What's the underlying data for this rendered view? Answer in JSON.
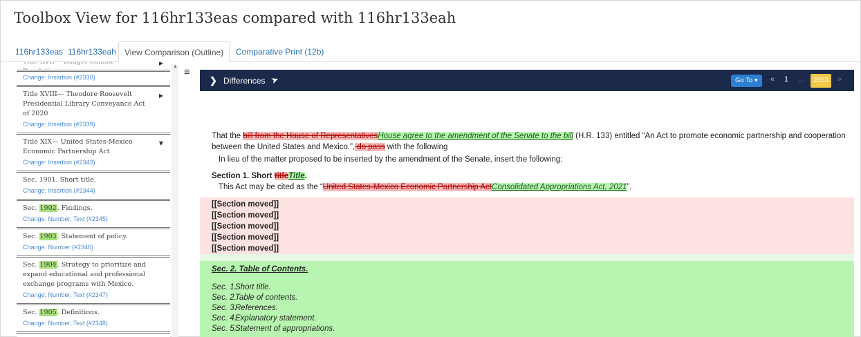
{
  "page_title": "Toolbox View for 116hr133eas compared with 116hr133eah",
  "tabs": [
    {
      "label": "116hr133eas"
    },
    {
      "label": "116hr133eah"
    },
    {
      "label": "View Comparison (Outline)"
    },
    {
      "label": "Comparative Print (12b)"
    }
  ],
  "sidebar": {
    "items": [
      {
        "title": "Title XVII— Budget Cannot Resolution",
        "change": "Change: Insertion (#2330)"
      },
      {
        "title": "Title XVIII— Theodore Roosevelt Presidential Library Conveyance Act of 2020",
        "change": "Change: Insertion (#2339)"
      },
      {
        "title": "Title XIX— United States-Mexico Economic Partnership Act",
        "change": "Change: Insertion (#2343)"
      },
      {
        "title": "Sec. 1901. Short title.",
        "change": "Change: Insertion (#2344)"
      },
      {
        "title_pre": "Sec. ",
        "title_hl": "1902",
        "title_post": ". Findings.",
        "change": "Change: Number, Text (#2345)"
      },
      {
        "title_pre": "Sec. ",
        "title_hl": "1903",
        "title_post": ". Statement of policy.",
        "change": "Change: Number (#2346)"
      },
      {
        "title_pre": "Sec. ",
        "title_hl": "1904",
        "title_post": ". Strategy to prioritize and expand educational and professional exchange programs with Mexico.",
        "change": "Change: Number, Text (#2347)"
      },
      {
        "title_pre": "Sec. ",
        "title_hl": "1905",
        "title_post": ". Definitions.",
        "change": "Change: Number, Text (#2348)"
      }
    ]
  },
  "differences": {
    "label": "Differences",
    "goto_label": "Go To ▾",
    "prev_icon": "«",
    "page_first": "1",
    "page_dots": "...",
    "page_last": "2353",
    "next_icon": "»"
  },
  "doc": {
    "p1_a": "That the ",
    "p1_del": "bill from the House of Representatives",
    "p1_ins": "House agree to the amendment of the Senate to the bill",
    "p1_b": " (H.R. 133) entitled “An Act to promote economic partnership and cooperation between the United States and Mexico.”,",
    "p1_del2": " do pass",
    "p1_c": " with the following",
    "p2": "In lieu of the matter proposed to be inserted by the amendment of the Senate, insert the following:",
    "sec_head_a": "Section 1. Short ",
    "sec_head_del": "title",
    "sec_head_ins": "Title",
    "sec_head_b": ".",
    "sec_body_a": "This Act may be cited as the “",
    "sec_body_del": "United States-Mexico Economic Partnership Act",
    "sec_body_ins": "Consolidated Appropriations Act, 2021",
    "sec_body_b": "”.",
    "moved": [
      "[[Section moved]]",
      "[[Section moved]]",
      "[[Section moved]]",
      "[[Section moved]]",
      "[[Section moved]]"
    ],
    "toc_title": "Sec. 2. Table of Contents.",
    "toc": [
      {
        "sec": "Sec. 1.",
        "title": "Short title."
      },
      {
        "sec": "Sec. 2.",
        "title": "Table of contents."
      },
      {
        "sec": "Sec. 3.",
        "title": "References."
      },
      {
        "sec": "Sec. 4.",
        "title": "Explanatory statement."
      },
      {
        "sec": "Sec. 5.",
        "title": "Statement of appropriations."
      }
    ]
  },
  "colors": {
    "nav_bar": "#1b2a4a",
    "deletion": "#f6b9b9",
    "insertion": "#b8f5b0",
    "moved_bg": "#fde2e2",
    "pager_active": "#f2c84b"
  }
}
